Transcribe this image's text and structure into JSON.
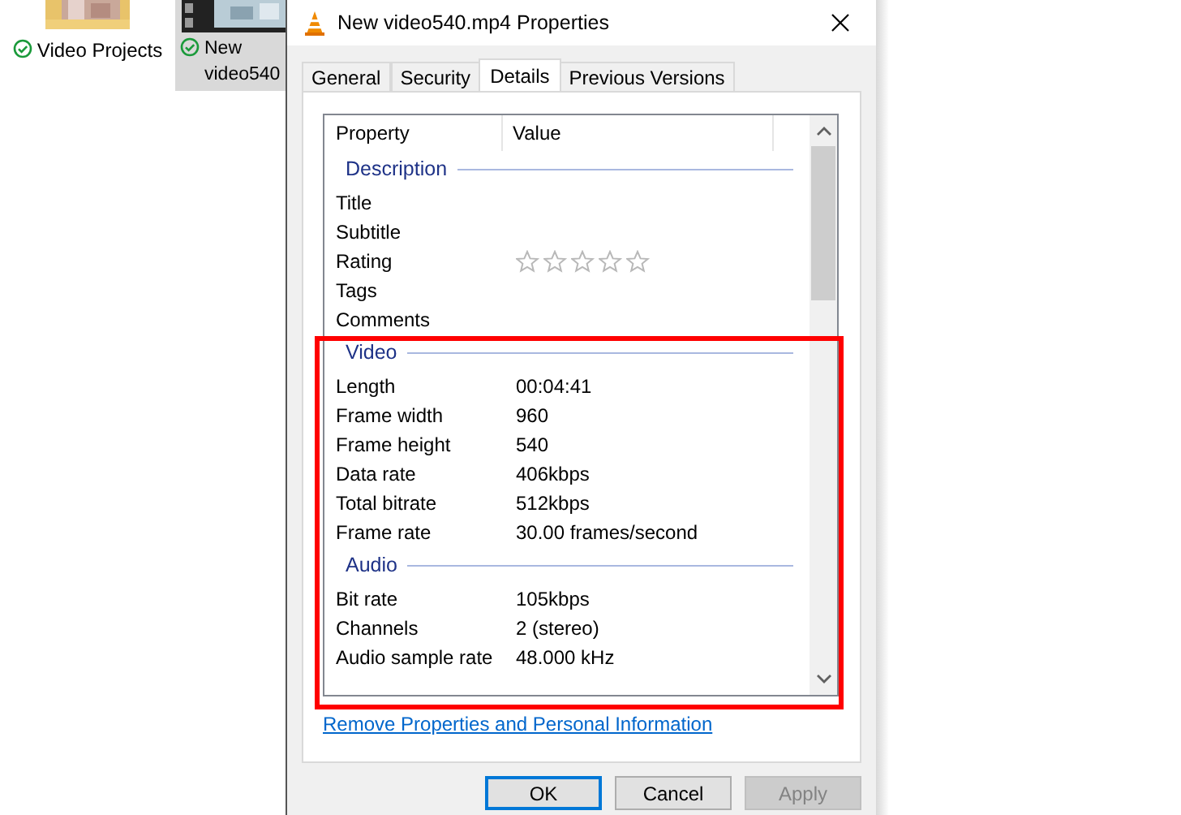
{
  "desktop_items": [
    {
      "label": "Video Projects",
      "kind": "folder",
      "selected": false
    },
    {
      "label": "New video540",
      "kind": "video",
      "selected": true
    }
  ],
  "dialog": {
    "title": "New video540.mp4 Properties",
    "tabs": [
      {
        "label": "General",
        "selected": false
      },
      {
        "label": "Security",
        "selected": false
      },
      {
        "label": "Details",
        "selected": true
      },
      {
        "label": "Previous Versions",
        "selected": false
      }
    ],
    "columns": [
      "Property",
      "Value"
    ],
    "sections": [
      {
        "title": "Description",
        "rows": [
          {
            "property": "Title"
          },
          {
            "property": "Subtitle"
          },
          {
            "property": "Rating",
            "stars": 0
          },
          {
            "property": "Tags"
          },
          {
            "property": "Comments"
          }
        ]
      },
      {
        "title": "Video",
        "rows": [
          {
            "property": "Length",
            "value": "00:04:41"
          },
          {
            "property": "Frame width",
            "value": "960"
          },
          {
            "property": "Frame height",
            "value": "540"
          },
          {
            "property": "Data rate",
            "value": "406kbps"
          },
          {
            "property": "Total bitrate",
            "value": "512kbps"
          },
          {
            "property": "Frame rate",
            "value": "30.00 frames/second"
          }
        ]
      },
      {
        "title": "Audio",
        "rows": [
          {
            "property": "Bit rate",
            "value": "105kbps"
          },
          {
            "property": "Channels",
            "value": "2 (stereo)"
          },
          {
            "property": "Audio sample rate",
            "value": "48.000 kHz"
          }
        ]
      }
    ],
    "link": "Remove Properties and Personal Information",
    "buttons": [
      {
        "label": "OK",
        "default": true,
        "disabled": false
      },
      {
        "label": "Cancel",
        "default": false,
        "disabled": false
      },
      {
        "label": "Apply",
        "default": false,
        "disabled": true
      }
    ],
    "highlight": true
  }
}
